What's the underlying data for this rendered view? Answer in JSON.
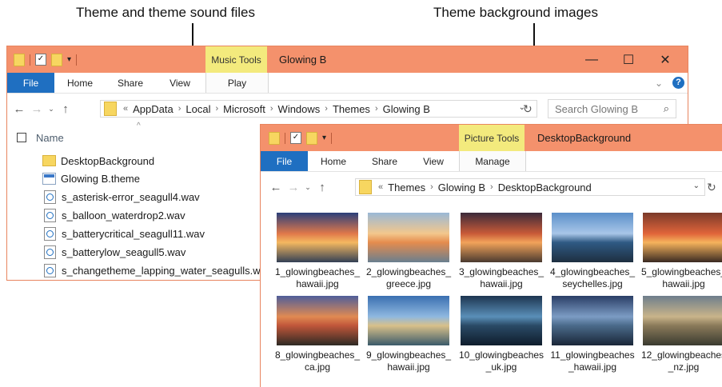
{
  "callouts": {
    "left": "Theme and theme sound files",
    "right": "Theme background images"
  },
  "icons": {
    "minimize": "minimize-icon",
    "maximize": "maximize-icon",
    "close": "close-icon",
    "help": "help-icon",
    "search": "search-icon",
    "back": "back-arrow-icon",
    "forward": "forward-arrow-icon",
    "up": "up-arrow-icon",
    "refresh": "refresh-icon",
    "folder": "folder-icon"
  },
  "glyphs": {
    "back": "←",
    "forward": "→",
    "recent": "⌄",
    "up": "↑",
    "sep": "›",
    "dropdown": "⌄",
    "refresh": "↻",
    "search": "⌕",
    "min": "—",
    "max": "☐",
    "close": "✕",
    "ribbon_chevron": "⌄",
    "help": "?",
    "sort": "^",
    "chevrons": "«",
    "qat_check": "✓",
    "qat_arrow": "▾"
  },
  "win1": {
    "title": "Glowing B",
    "context_tab": "Music Tools",
    "ribbon_tabs": [
      "File",
      "Home",
      "Share",
      "View"
    ],
    "context_subtab": "Play",
    "breadcrumb": [
      "AppData",
      "Local",
      "Microsoft",
      "Windows",
      "Themes",
      "Glowing B"
    ],
    "search_placeholder": "Search Glowing B",
    "column_name": "Name",
    "files": [
      {
        "name": "DesktopBackground",
        "type": "folder"
      },
      {
        "name": "Glowing B.theme",
        "type": "theme"
      },
      {
        "name": "s_asterisk-error_seagull4.wav",
        "type": "wav"
      },
      {
        "name": "s_balloon_waterdrop2.wav",
        "type": "wav"
      },
      {
        "name": "s_batterycritical_seagull11.wav",
        "type": "wav"
      },
      {
        "name": "s_batterylow_seagull5.wav",
        "type": "wav"
      },
      {
        "name": "s_changetheme_lapping_water_seagulls.wav",
        "type": "wav"
      }
    ]
  },
  "win2": {
    "title": "DesktopBackground",
    "context_tab": "Picture Tools",
    "ribbon_tabs": [
      "File",
      "Home",
      "Share",
      "View"
    ],
    "context_subtab": "Manage",
    "breadcrumb": [
      "Themes",
      "Glowing B",
      "DesktopBackground"
    ],
    "thumbnails": [
      {
        "caption": "1_glowingbeaches_hawaii.jpg",
        "colors": [
          "#2b3f7a",
          "#e0784a",
          "#f4b860",
          "#334055"
        ]
      },
      {
        "caption": "2_glowingbeaches_greece.jpg",
        "colors": [
          "#9ab8d6",
          "#f3c78c",
          "#e58c4e",
          "#6a7f8f"
        ]
      },
      {
        "caption": "3_glowingbeaches_hawaii.jpg",
        "colors": [
          "#3b2a3a",
          "#c85a38",
          "#f2a35a",
          "#4a3a30"
        ]
      },
      {
        "caption": "4_glowingbeaches_seychelles.jpg",
        "colors": [
          "#5b8fc9",
          "#a9c6e8",
          "#2f5a84",
          "#1e2f40"
        ]
      },
      {
        "caption": "5_glowingbeaches_hawaii.jpg",
        "colors": [
          "#7a3a2a",
          "#e0643a",
          "#f5b35c",
          "#3a2a22"
        ]
      },
      {
        "caption": "8_glowingbeaches_ca.jpg",
        "colors": [
          "#4f5e9a",
          "#e08a52",
          "#c0563a",
          "#2e2a24"
        ]
      },
      {
        "caption": "9_glowingbeaches_hawaii.jpg",
        "colors": [
          "#3a6fb0",
          "#8fb8e0",
          "#d8c08a",
          "#3b5a6a"
        ]
      },
      {
        "caption": "10_glowingbeaches_uk.jpg",
        "colors": [
          "#1d3550",
          "#5a8fb8",
          "#2a4a66",
          "#0f1d2c"
        ]
      },
      {
        "caption": "11_glowingbeaches_hawaii.jpg",
        "colors": [
          "#2a3e66",
          "#7c9cc4",
          "#4a6a8a",
          "#1a2638"
        ]
      },
      {
        "caption": "12_glowingbeaches_nz.jpg",
        "colors": [
          "#6e7e8c",
          "#c9b48a",
          "#8a7a5a",
          "#3a3a30"
        ]
      }
    ]
  }
}
